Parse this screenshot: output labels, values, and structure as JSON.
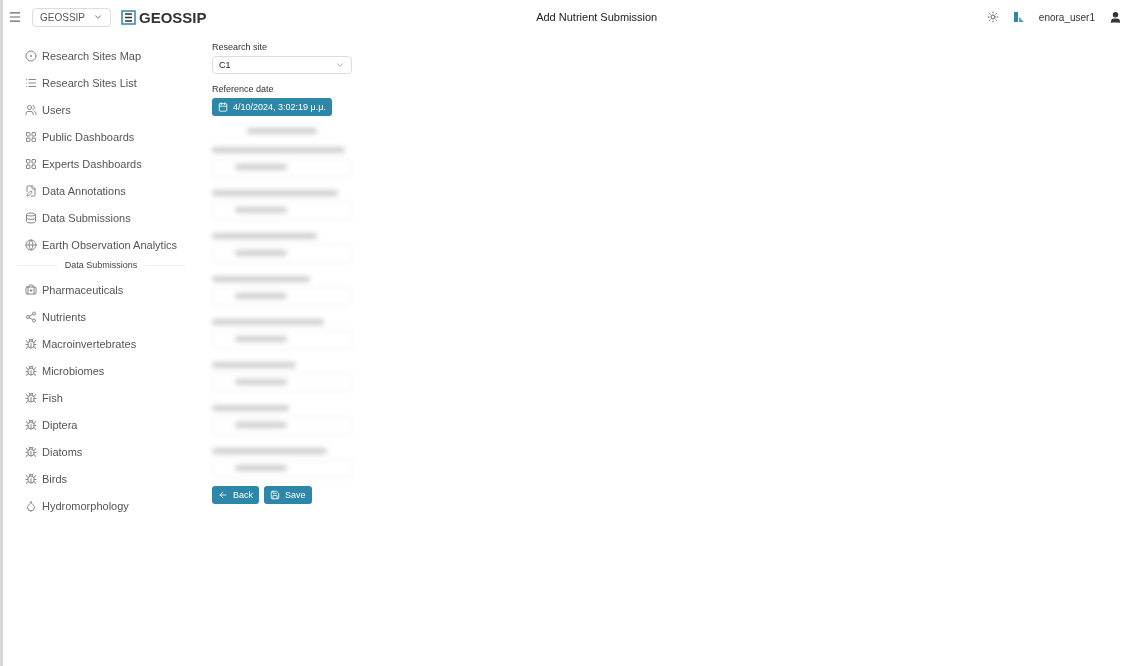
{
  "topbar": {
    "workspace_select": "GEOSSIP",
    "logo_text": "GEOSSIP",
    "title": "Add Nutrient Submission",
    "username": "enora_user1"
  },
  "sidebar": {
    "main_items": [
      {
        "label": "Research Sites Map",
        "selected": false
      },
      {
        "label": "Research Sites List",
        "selected": false
      },
      {
        "label": "Users",
        "selected": false
      },
      {
        "label": "Public Dashboards",
        "selected": false
      },
      {
        "label": "Experts Dashboards",
        "selected": false
      },
      {
        "label": "Data Annotations",
        "selected": false
      },
      {
        "label": "Data Submissions",
        "selected": false
      },
      {
        "label": "Earth Observation Analytics",
        "selected": false
      }
    ],
    "section_title": "Data Submissions",
    "submission_items": [
      {
        "label": "Pharmaceuticals",
        "selected": false
      },
      {
        "label": "Nutrients",
        "selected": false
      },
      {
        "label": "Macroinvertebrates",
        "selected": false
      },
      {
        "label": "Microbiomes",
        "selected": false
      },
      {
        "label": "Fish",
        "selected": false
      },
      {
        "label": "Diptera",
        "selected": false
      },
      {
        "label": "Diatoms",
        "selected": false
      },
      {
        "label": "Birds",
        "selected": false
      },
      {
        "label": "Hydromorphology",
        "selected": false
      }
    ]
  },
  "form": {
    "site_label": "Research site",
    "site_value": "C1",
    "date_label": "Reference date",
    "date_value": "4/10/2024, 3:02:19 μ.μ.",
    "buttons": [
      "Back",
      "Save"
    ]
  }
}
